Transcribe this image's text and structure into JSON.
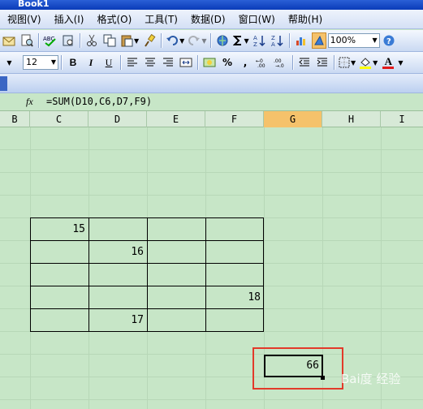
{
  "window": {
    "title": "Book1"
  },
  "menubar": {
    "items": [
      "视图(V)",
      "插入(I)",
      "格式(O)",
      "工具(T)",
      "数据(D)",
      "窗口(W)",
      "帮助(H)"
    ]
  },
  "toolbar_standard": {
    "zoom": "100%"
  },
  "toolbar_formatting": {
    "font_size": "12",
    "bold": "B",
    "italic": "I",
    "underline": "U",
    "percent": "%",
    "font_color_label": "A"
  },
  "formula_bar": {
    "fx_label": "fx",
    "formula": "=SUM(D10,C6,D7,F9)"
  },
  "column_headers": [
    "B",
    "C",
    "D",
    "E",
    "F",
    "G",
    "H",
    "I"
  ],
  "selected_column": "G",
  "cells": {
    "C6": "15",
    "D7": "16",
    "F9": "18",
    "D10": "17"
  },
  "active_cell": {
    "ref": "G12",
    "value": "66"
  },
  "colors": {
    "sheet_background": "#c7e6c7",
    "highlight_border": "#e23a2a",
    "selected_header": "#f5c26b"
  },
  "watermark": "Bai度 经验"
}
